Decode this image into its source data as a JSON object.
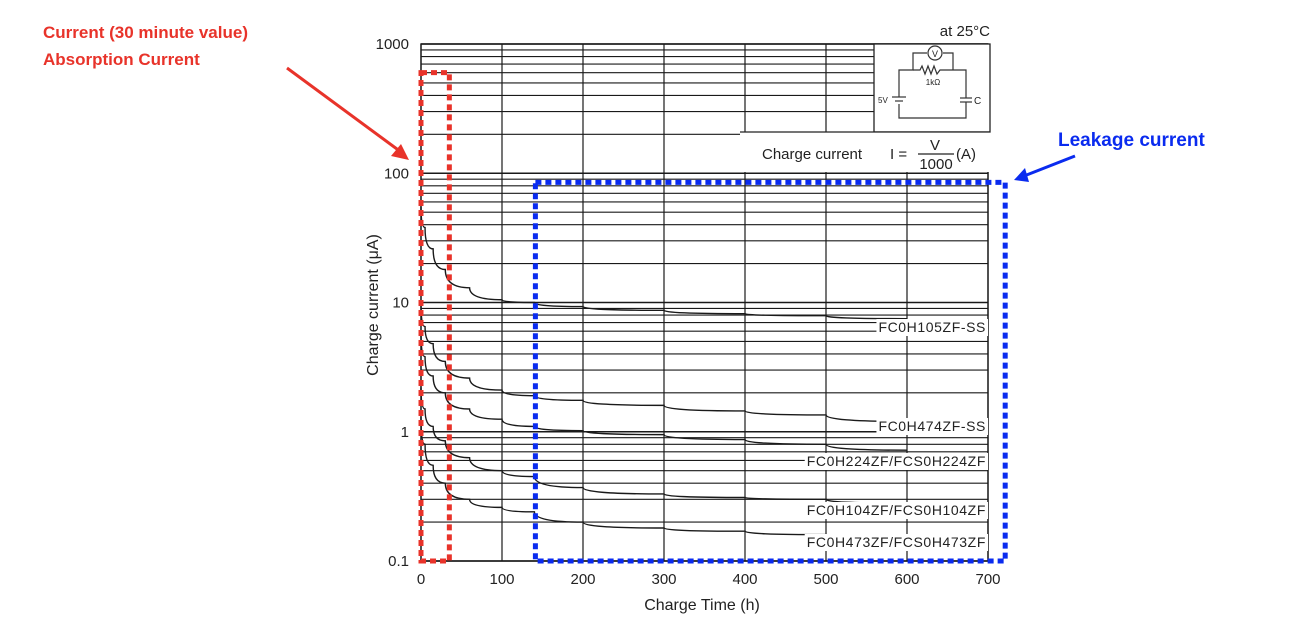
{
  "chart_data": {
    "type": "line",
    "title": "",
    "condition_note": "at 25°C",
    "xlabel": "Charge Time (h)",
    "ylabel": "Charge current (μA)",
    "xlim": [
      0,
      700
    ],
    "ylim": [
      0.1,
      1000
    ],
    "yscale": "log",
    "grid": true,
    "x_ticks": [
      0,
      100,
      200,
      300,
      400,
      500,
      600,
      700
    ],
    "x_tick_labels": [
      "0",
      "100",
      "200",
      "300",
      "400",
      "500",
      "600",
      "700"
    ],
    "y_ticks": [
      0.1,
      1,
      10,
      100,
      1000
    ],
    "y_tick_labels": [
      "0.1",
      "1",
      "10",
      "100",
      "1000"
    ],
    "series": [
      {
        "name": "FC0H105ZF-SS",
        "x": [
          0,
          5,
          15,
          30,
          60,
          100,
          140,
          200,
          300,
          400,
          500,
          600
        ],
        "values": [
          55,
          38,
          26,
          18,
          13,
          10.5,
          10,
          9.3,
          8.7,
          8.2,
          7.9,
          7.5
        ]
      },
      {
        "name": "FC0H474ZF-SS",
        "x": [
          0,
          5,
          15,
          30,
          60,
          100,
          140,
          200,
          300,
          400,
          500,
          600
        ],
        "values": [
          10,
          6.5,
          4.8,
          3.5,
          2.6,
          2.1,
          1.9,
          1.75,
          1.6,
          1.45,
          1.35,
          1.2
        ]
      },
      {
        "name": "FC0H224ZF/FCS0H224ZF",
        "x": [
          0,
          5,
          15,
          30,
          60,
          100,
          140,
          200,
          300,
          400,
          500,
          600
        ],
        "values": [
          6,
          3.8,
          2.7,
          2.0,
          1.5,
          1.25,
          1.1,
          1.02,
          0.95,
          0.87,
          0.8,
          0.72
        ]
      },
      {
        "name": "FC0H104ZF/FCS0H104ZF",
        "x": [
          0,
          5,
          15,
          30,
          60,
          100,
          140,
          200,
          300,
          400,
          500,
          600
        ],
        "values": [
          2.2,
          1.5,
          1.1,
          0.85,
          0.63,
          0.5,
          0.45,
          0.37,
          0.33,
          0.31,
          0.3,
          0.28
        ]
      },
      {
        "name": "FC0H473ZF/FCS0H473ZF",
        "x": [
          0,
          5,
          15,
          30,
          60,
          100,
          140,
          200,
          300,
          400,
          500,
          600
        ],
        "values": [
          1.3,
          0.8,
          0.55,
          0.4,
          0.3,
          0.26,
          0.24,
          0.2,
          0.18,
          0.17,
          0.16,
          0.15
        ]
      }
    ],
    "inset": {
      "circuit": {
        "source_label": "5V",
        "resistor_label": "1kΩ",
        "capacitor_label": "C",
        "meter_label": "V"
      },
      "formula_prefix": "Charge current",
      "formula_lhs": "I =",
      "formula_numerator": "V",
      "formula_denominator": "1000",
      "formula_unit": "(A)"
    },
    "annotations": [
      {
        "id": "absorption",
        "lines": [
          "Current (30 minute value)",
          "Absorption Current"
        ],
        "color": "#e8332a",
        "region_x": [
          0,
          35
        ],
        "region_y": [
          0.1,
          600
        ]
      },
      {
        "id": "leakage",
        "lines": [
          "Leakage current"
        ],
        "color": "#0a2bef",
        "region_x": [
          140,
          720
        ],
        "region_y": [
          0.1,
          85
        ]
      }
    ]
  }
}
